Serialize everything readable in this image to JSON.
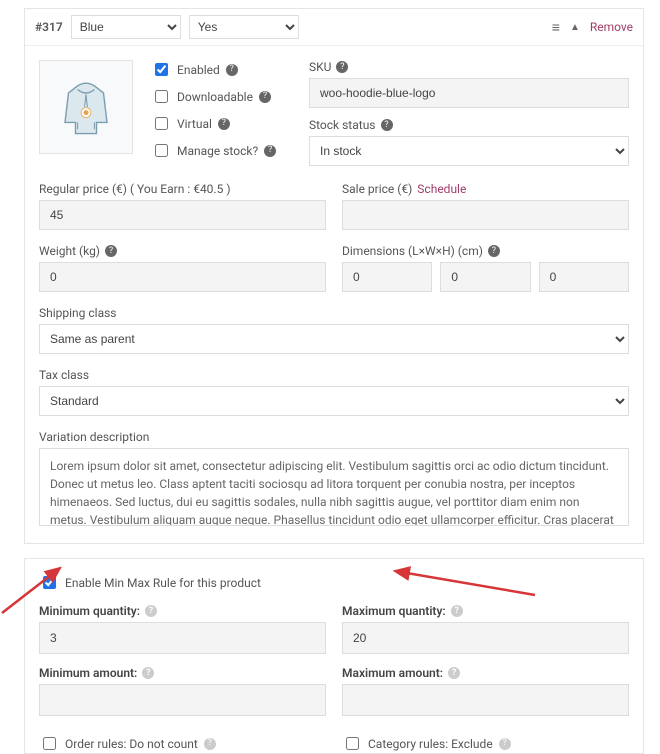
{
  "header": {
    "variation_id": "#317",
    "attr1": "Blue",
    "attr2": "Yes",
    "remove": "Remove"
  },
  "checks": {
    "enabled": "Enabled",
    "downloadable": "Downloadable",
    "virtual": "Virtual",
    "manage_stock": "Manage stock?"
  },
  "sku": {
    "label": "SKU",
    "value": "woo-hoodie-blue-logo"
  },
  "stock": {
    "label": "Stock status",
    "value": "In stock"
  },
  "price": {
    "regular_label": "Regular price (€) ( You Earn : €40.5 )",
    "regular_value": "45",
    "sale_label": "Sale price (€)",
    "schedule": "Schedule"
  },
  "weight": {
    "label": "Weight (kg)",
    "value": "0"
  },
  "dims": {
    "label": "Dimensions (L×W×H) (cm)",
    "l": "0",
    "w": "0",
    "h": "0"
  },
  "shipping": {
    "label": "Shipping class",
    "value": "Same as parent"
  },
  "tax": {
    "label": "Tax class",
    "value": "Standard"
  },
  "desc": {
    "label": "Variation description",
    "value": "Lorem ipsum dolor sit amet, consectetur adipiscing elit. Vestibulum sagittis orci ac odio dictum tincidunt. Donec ut metus leo. Class aptent taciti sociosqu ad litora torquent per conubia nostra, per inceptos himenaeos. Sed luctus, dui eu sagittis sodales, nulla nibh sagittis augue, vel porttitor diam enim non metus. Vestibulum aliquam augue neque. Phasellus tincidunt odio eget ullamcorper efficitur. Cras placerat ut"
  },
  "minmax": {
    "enable_rule": "Enable Min Max Rule for this product",
    "min_qty_label": "Minimum quantity:",
    "min_qty": "3",
    "max_qty_label": "Maximum quantity:",
    "max_qty": "20",
    "min_amt_label": "Minimum amount:",
    "max_amt_label": "Maximum amount:",
    "order_rules": "Order rules: Do not count",
    "category_rules": "Category rules: Exclude"
  }
}
